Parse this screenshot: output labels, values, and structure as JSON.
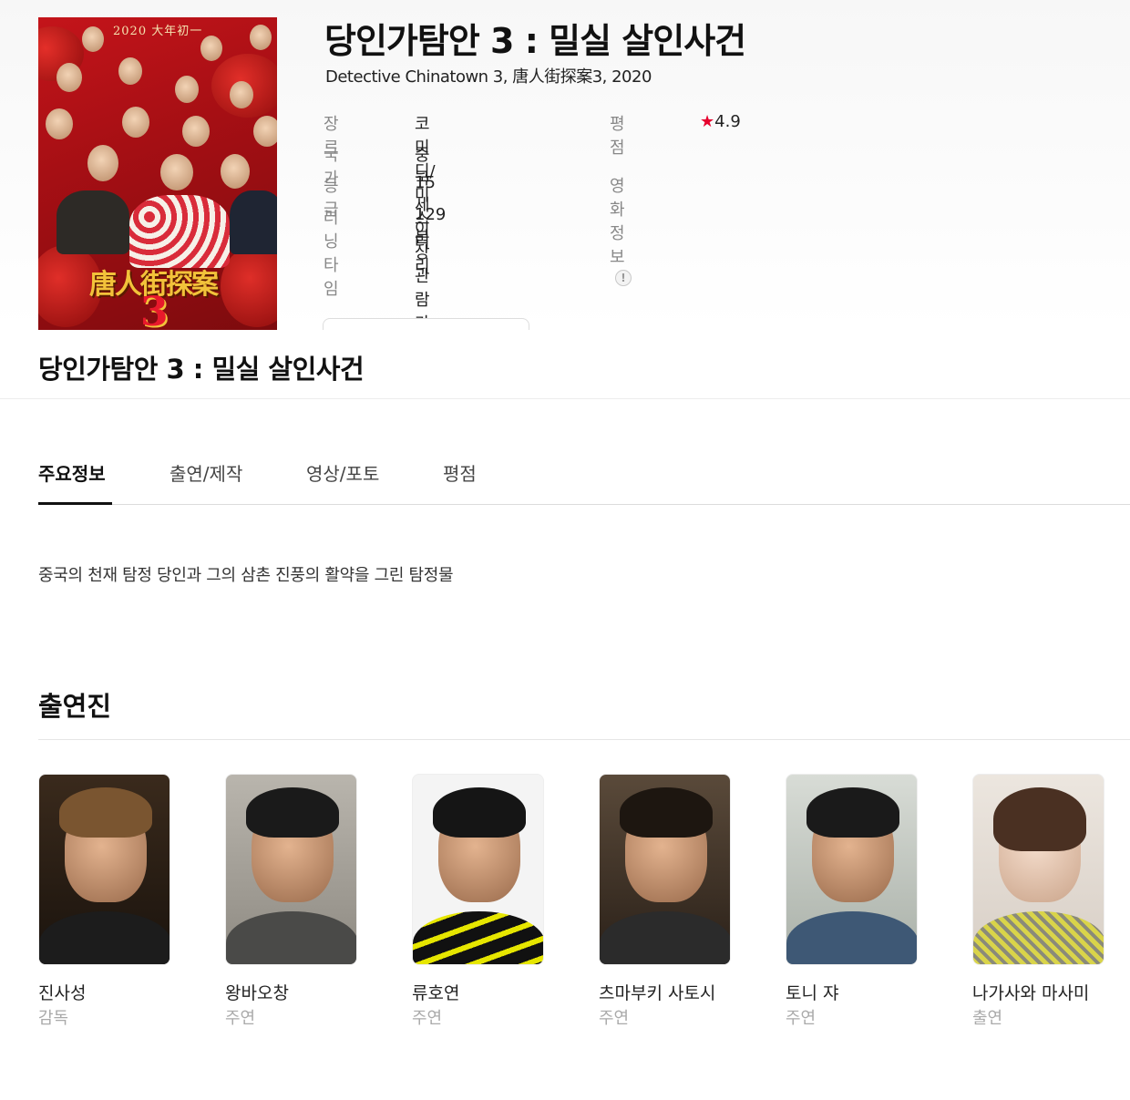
{
  "movie": {
    "title": "당인가탐안 3 : 밀실 살인사건",
    "subtitle": "Detective Chinatown 3, 唐人街探案3, 2020",
    "poster": {
      "year_text": "2020 大年初一",
      "logo_text": "唐人街探案",
      "number_text": "3"
    }
  },
  "info": {
    "genre_label": "장르",
    "genre_value": "코미디/미스터리",
    "country_label": "국가",
    "country_value": "중국",
    "rating_label": "등급",
    "rating_value": "15세이상관람가",
    "runtime_label": "러닝타임",
    "runtime_value": "129분",
    "score_label": "평점",
    "score_star": "★",
    "score_value": "4.9",
    "movieinfo_label": "영화정보",
    "alert_icon": "!"
  },
  "sticky": {
    "title": "당인가탐안 3 : 밀실 살인사건"
  },
  "tabs": [
    {
      "label": "주요정보"
    },
    {
      "label": "출연/제작"
    },
    {
      "label": "영상/포토"
    },
    {
      "label": "평점"
    }
  ],
  "synopsis": "중국의 천재 탐정 당인과 그의 삼촌 진풍의 활약을 그린 탐정물",
  "cast_section": {
    "title": "출연진"
  },
  "cast": [
    {
      "name": "진사성",
      "role": "감독"
    },
    {
      "name": "왕바오창",
      "role": "주연"
    },
    {
      "name": "류호연",
      "role": "주연"
    },
    {
      "name": "츠마부키 사토시",
      "role": "주연"
    },
    {
      "name": "토니 쟈",
      "role": "주연"
    },
    {
      "name": "나가사와 마사미",
      "role": "출연"
    }
  ],
  "colors": {
    "accent_star": "#e6002d",
    "text_primary": "#111111",
    "text_muted": "#888888"
  }
}
